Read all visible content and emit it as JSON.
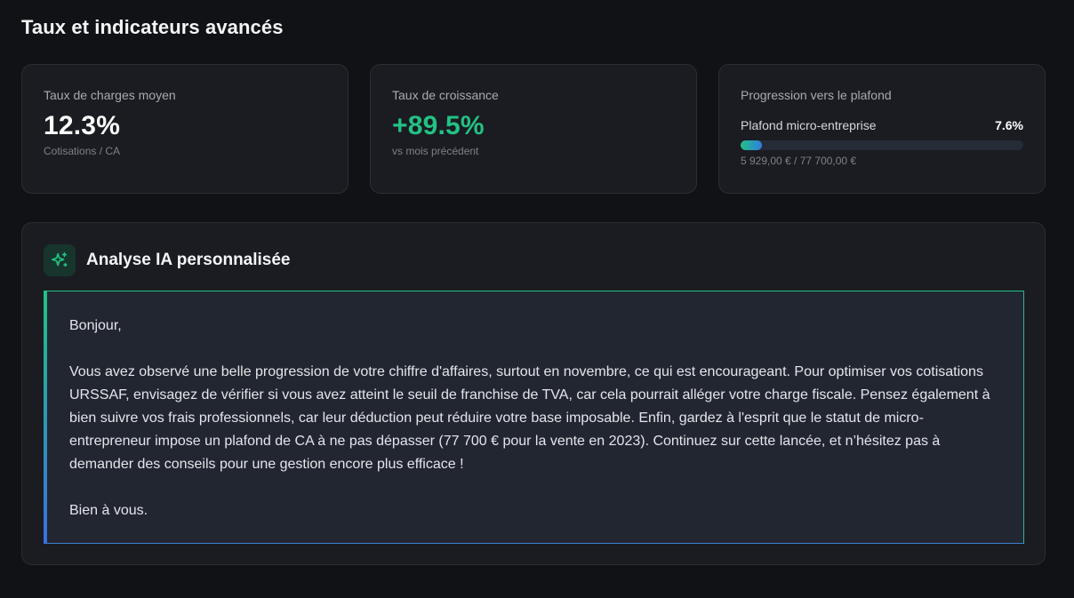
{
  "section": {
    "title": "Taux et indicateurs avancés"
  },
  "stats": [
    {
      "label": "Taux de charges moyen",
      "value": "12.3%",
      "sub": "Cotisations / CA"
    },
    {
      "label": "Taux de croissance",
      "value": "+89.5%",
      "sub": "vs mois précédent"
    }
  ],
  "plafond": {
    "label": "Progression vers le plafond",
    "name": "Plafond micro-entreprise",
    "percent_text": "7.6%",
    "percent": 7.6,
    "amount": "5 929,00 € / 77 700,00 €"
  },
  "ai": {
    "icon": "sparkles-icon",
    "title": "Analyse IA personnalisée",
    "greeting": "Bonjour,",
    "body": "Vous avez observé une belle progression de votre chiffre d'affaires, surtout en novembre, ce qui est encourageant. Pour optimiser vos cotisations URSSAF, envisagez de vérifier si vous avez atteint le seuil de franchise de TVA, car cela pourrait alléger votre charge fiscale. Pensez également à bien suivre vos frais professionnels, car leur déduction peut réduire votre base imposable. Enfin, gardez à l'esprit que le statut de micro-entrepreneur impose un plafond de CA à ne pas dépasser (77 700 € pour la vente en 2023). Continuez sur cette lancée, et n’hésitez pas à demander des conseils pour une gestion encore plus efficace !",
    "closing": "Bien à vous."
  },
  "colors": {
    "background": "#111215",
    "card": "#1a1c21",
    "accent_green": "#22c284",
    "accent_blue": "#2f7de0"
  }
}
